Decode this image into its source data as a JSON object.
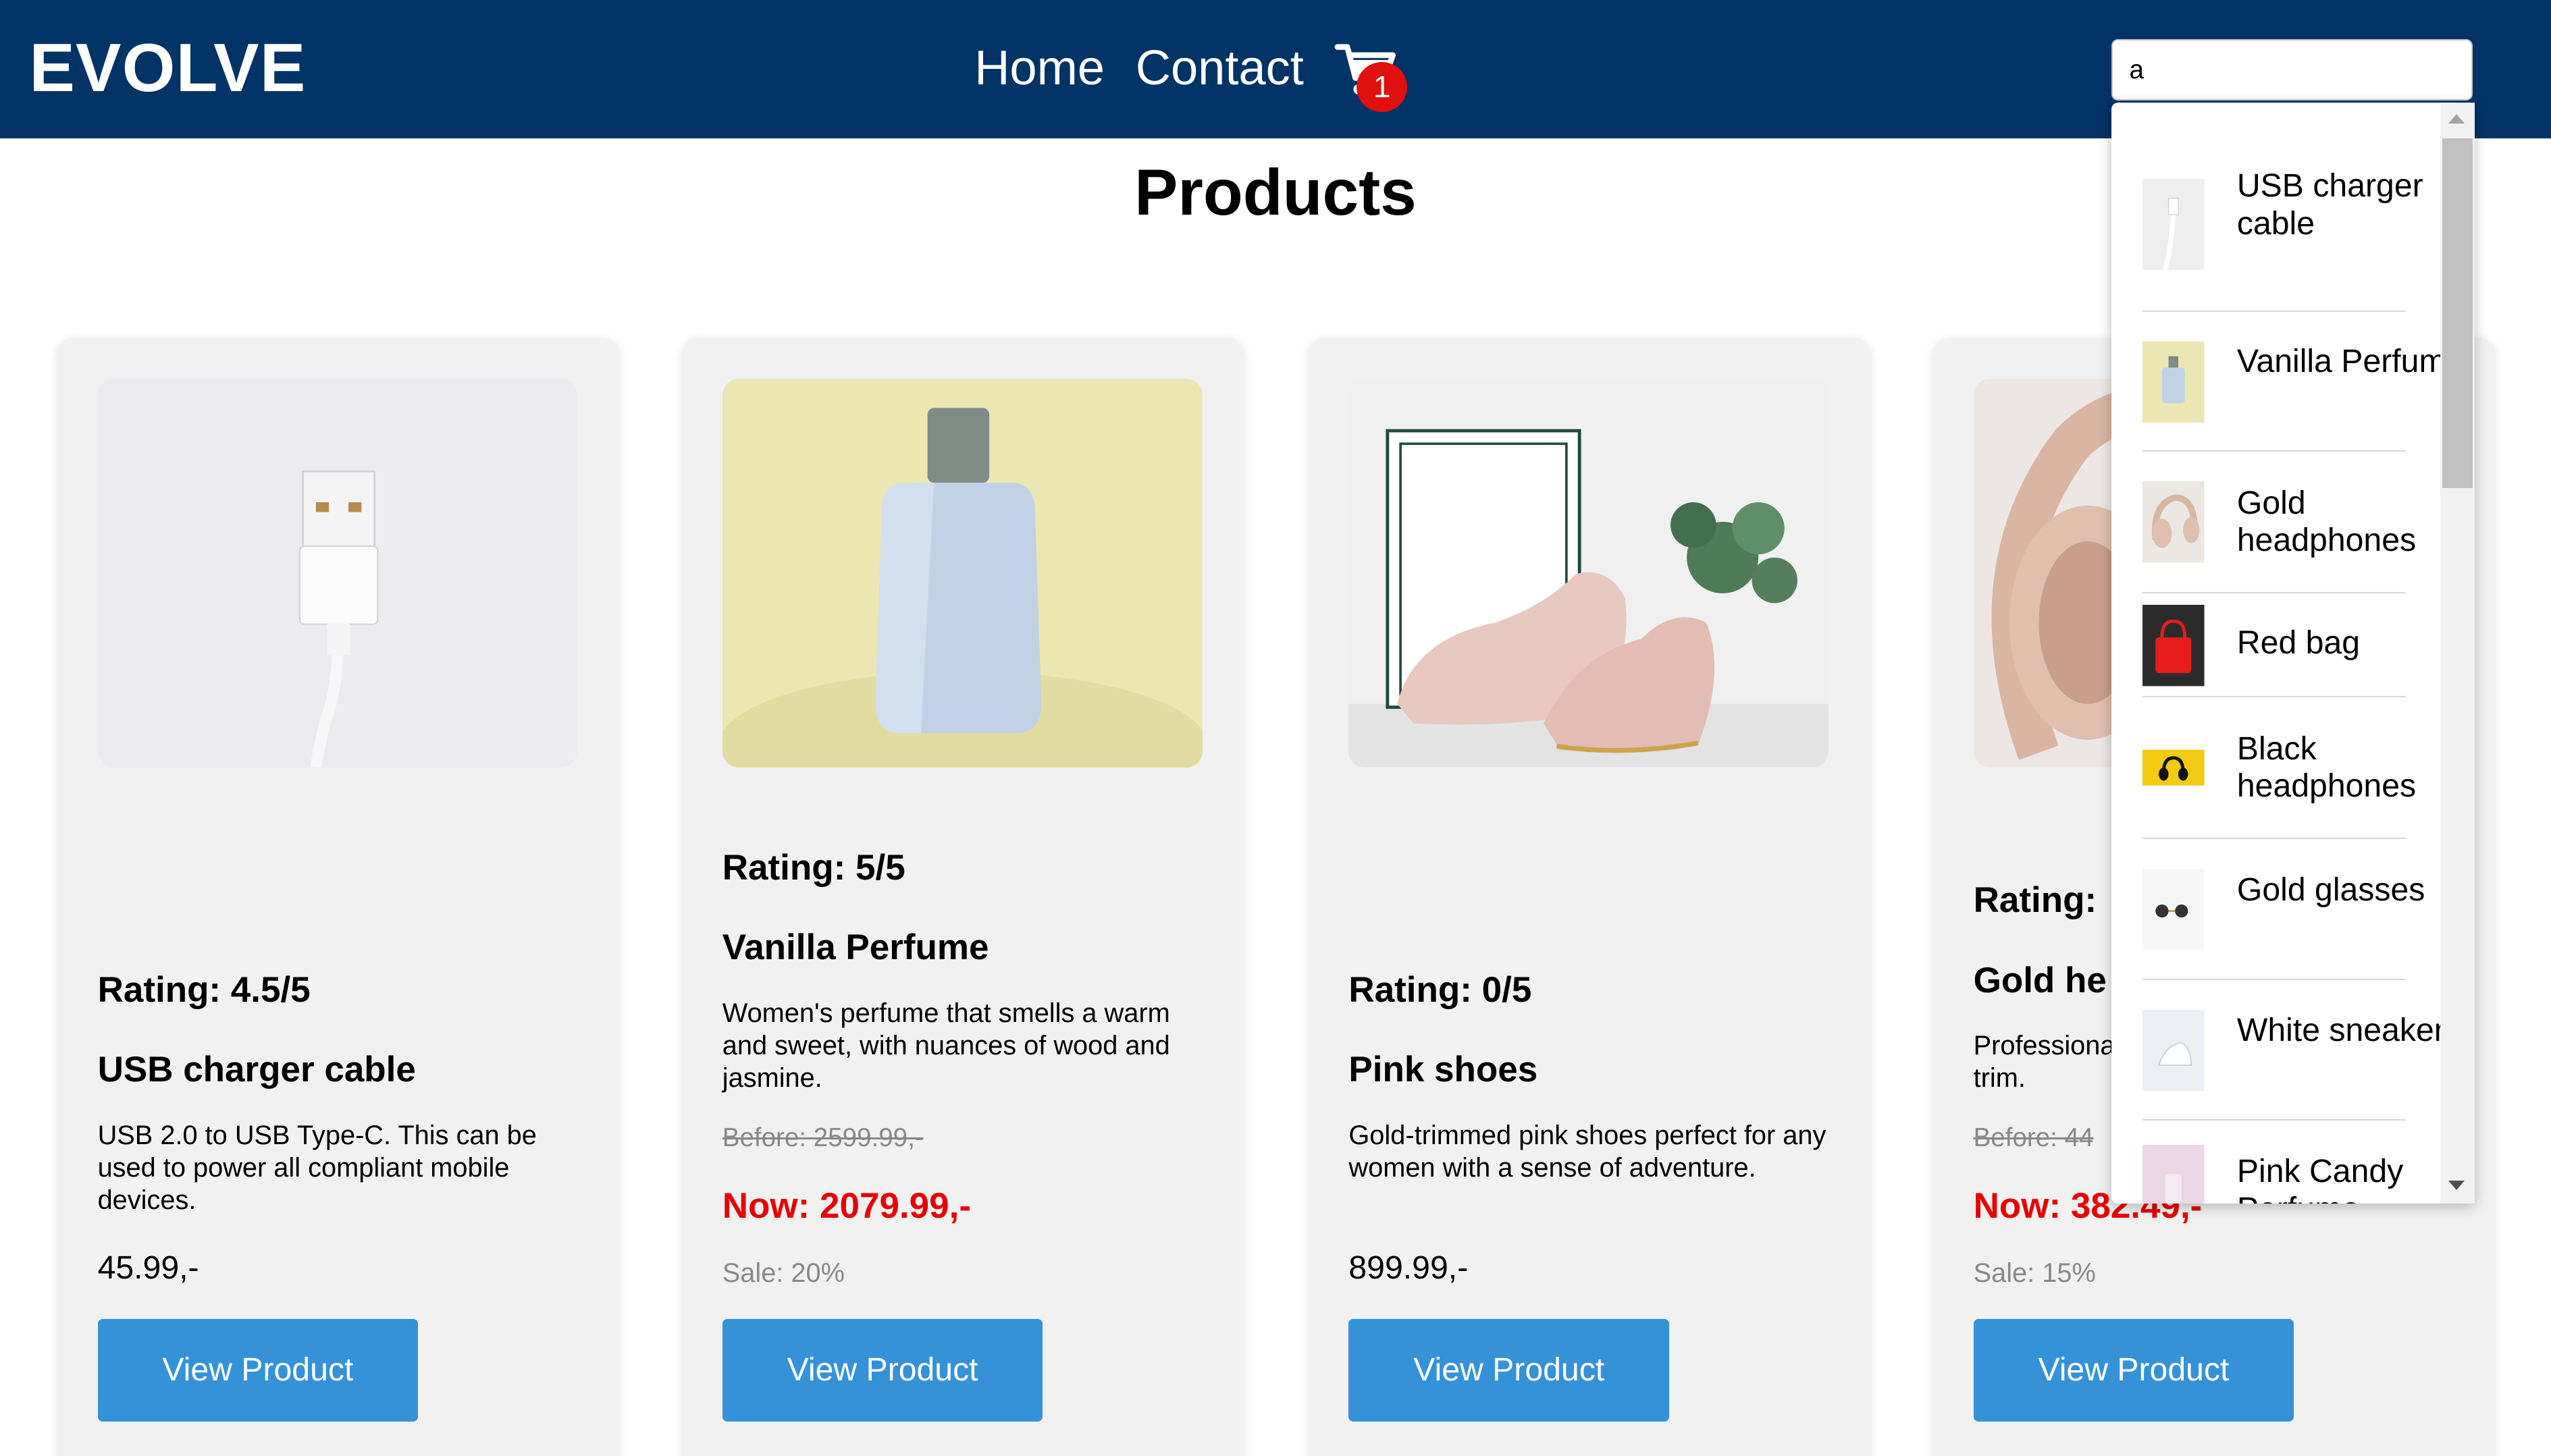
{
  "header": {
    "logo": "EVOLVE",
    "nav": {
      "home": "Home",
      "contact": "Contact"
    },
    "cart": {
      "icon": "cart-icon",
      "count": "1"
    },
    "search": {
      "value": "a"
    }
  },
  "main": {
    "title": "Products",
    "products": [
      {
        "rating": "Rating: 4.5/5",
        "name": "USB charger cable",
        "description": "USB 2.0 to USB Type-C. This can be used to power all compliant mobile devices.",
        "price": "45.99,-",
        "button": "View Product"
      },
      {
        "rating": "Rating: 5/5",
        "name": "Vanilla Perfume",
        "description": "Women's perfume that smells a warm and sweet, with nuances of wood and jasmine.",
        "before": "Before: 2599.99,-",
        "now": "Now: 2079.99,-",
        "sale": "Sale: 20%",
        "button": "View Product"
      },
      {
        "rating": "Rating: 0/5",
        "name": "Pink shoes",
        "description": "Gold-trimmed pink shoes perfect for any women with a sense of adventure.",
        "price": "899.99,-",
        "button": "View Product"
      },
      {
        "rating": "Rating:",
        "name": "Gold he",
        "description": "Professiona trim.",
        "before": "Before: 44",
        "now": "Now: 382.49,-",
        "sale": "Sale: 15%",
        "button": "View Product"
      }
    ]
  },
  "search_dropdown": {
    "items": [
      {
        "label": "USB charger cable"
      },
      {
        "label": "Vanilla Perfume"
      },
      {
        "label": "Gold headphones"
      },
      {
        "label": "Red bag"
      },
      {
        "label": "Black headphones"
      },
      {
        "label": "Gold glasses"
      },
      {
        "label": "White sneakers"
      },
      {
        "label": "Pink Candy Perfume"
      }
    ]
  },
  "colors": {
    "header_bg": "#003366",
    "button_bg": "#3592d8",
    "sale_price": "#e60000",
    "badge": "#e0100f",
    "card_bg": "#f1f1f1"
  }
}
